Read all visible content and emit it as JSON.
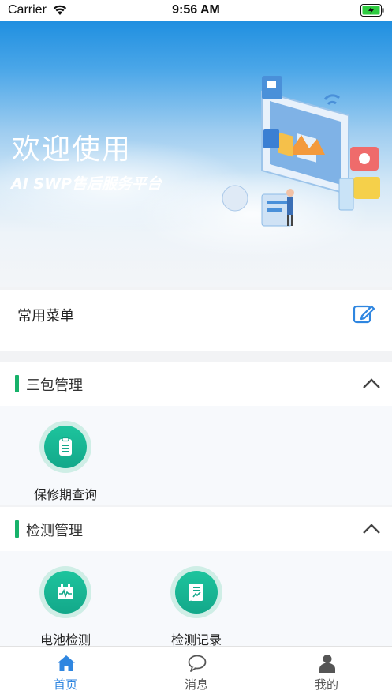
{
  "status_bar": {
    "carrier": "Carrier",
    "time": "9:56 AM"
  },
  "banner": {
    "welcome": "欢迎使用",
    "subtitle": "AI SWP售后服务平台"
  },
  "common_menu": {
    "title": "常用菜单",
    "edit_icon": "edit-icon"
  },
  "sections": [
    {
      "title": "三包管理",
      "items": [
        {
          "label": "保修期查询",
          "icon": "document-icon"
        }
      ]
    },
    {
      "title": "检测管理",
      "items": [
        {
          "label": "电池检测",
          "icon": "battery-monitor-icon"
        },
        {
          "label": "检测记录",
          "icon": "record-icon"
        }
      ]
    }
  ],
  "tabbar": {
    "items": [
      {
        "label": "首页",
        "icon": "home-icon",
        "active": true
      },
      {
        "label": "消息",
        "icon": "chat-icon",
        "active": false
      },
      {
        "label": "我的",
        "icon": "user-icon",
        "active": false
      }
    ]
  },
  "colors": {
    "accent": "#17b26a",
    "tab_active": "#2f86e0",
    "tile_fill": "#13a88a"
  }
}
